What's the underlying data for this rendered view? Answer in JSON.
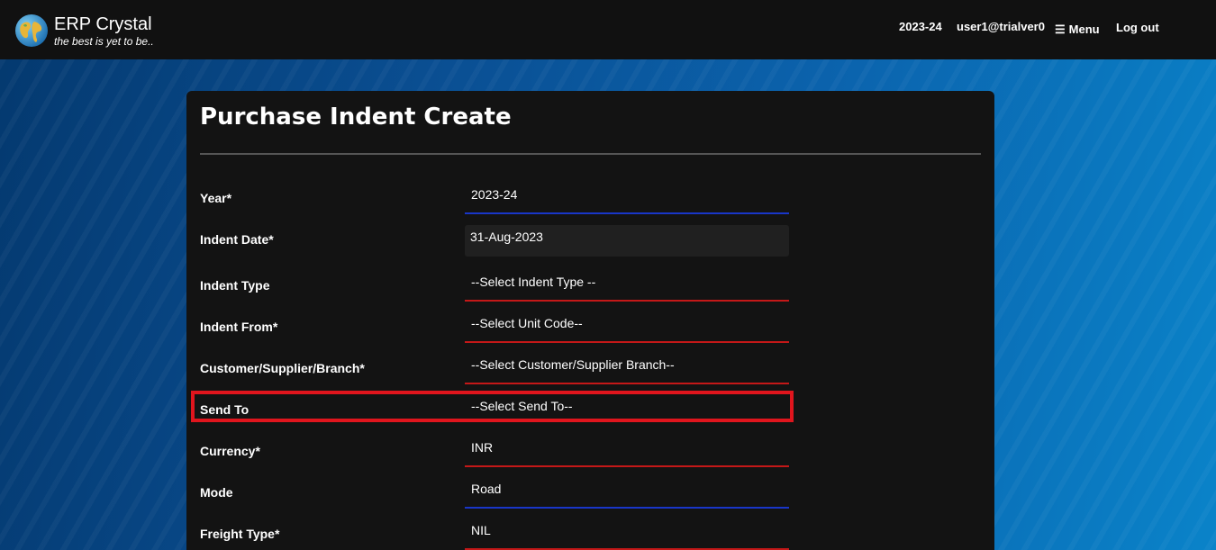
{
  "header": {
    "brand_name": "ERP Crystal",
    "tagline": "the best is yet to be..",
    "year": "2023-24",
    "user": "user1@trialver0",
    "menu_label": "Menu",
    "logout_label": "Log out",
    "logo_icon": "globe-icon",
    "menu_icon": "hamburger-icon"
  },
  "form": {
    "title": "Purchase Indent Create",
    "fields": [
      {
        "label": "Year*",
        "value": "2023-24"
      },
      {
        "label": "Indent Date*",
        "value": "31-Aug-2023"
      },
      {
        "label": "Indent Type",
        "value": "--Select Indent Type --"
      },
      {
        "label": "Indent From*",
        "value": "--Select Unit Code--"
      },
      {
        "label": "Customer/Supplier/Branch*",
        "value": "--Select Customer/Supplier Branch--"
      },
      {
        "label": "Send To",
        "value": "--Select Send To--"
      },
      {
        "label": "Currency*",
        "value": "INR"
      },
      {
        "label": "Mode",
        "value": "Road"
      },
      {
        "label": "Freight Type*",
        "value": "NIL"
      }
    ]
  },
  "colors": {
    "navbar": "#111111",
    "card": "#131313",
    "required_underline": "#c41818",
    "valid_underline": "#1936c8",
    "highlight_box": "#e0151d"
  }
}
